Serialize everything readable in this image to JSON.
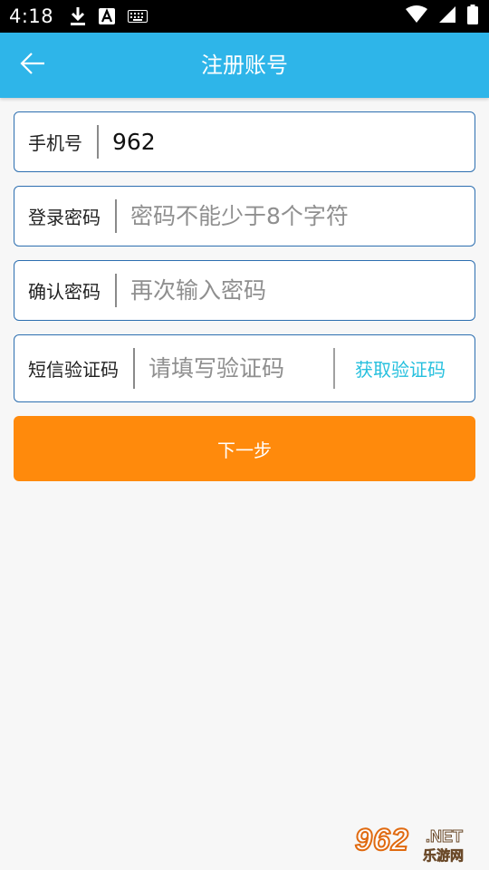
{
  "status_bar": {
    "time": "4:18",
    "icons": [
      "download-icon",
      "a-font-icon",
      "keyboard-icon",
      "wifi-icon",
      "signal-icon",
      "battery-icon"
    ]
  },
  "app_bar": {
    "title": "注册账号",
    "back_icon": "arrow-left-icon",
    "background": "#2eb5e9"
  },
  "form": {
    "phone": {
      "label": "手机号",
      "value": "962",
      "placeholder": ""
    },
    "password": {
      "label": "登录密码",
      "value": "",
      "placeholder": "密码不能少于8个字符"
    },
    "confirm": {
      "label": "确认密码",
      "value": "",
      "placeholder": "再次输入密码"
    },
    "sms": {
      "label": "短信验证码",
      "value": "",
      "placeholder": "请填写验证码",
      "get_code_label": "获取验证码"
    }
  },
  "next_button": {
    "label": "下一步",
    "color": "#ff8a0c"
  },
  "watermark": {
    "number": "962",
    "net": ".NET",
    "cn": "乐游网"
  },
  "colors": {
    "field_border": "#2d6fb0",
    "link": "#27c0de",
    "page_bg": "#f7f7f7"
  }
}
